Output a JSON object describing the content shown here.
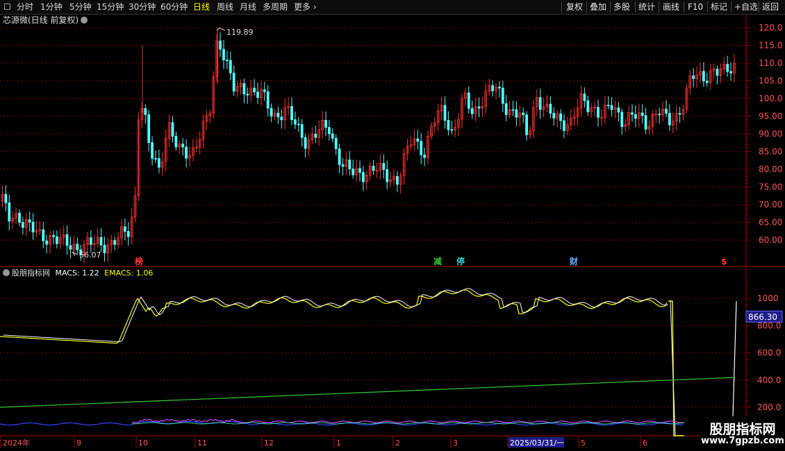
{
  "toolbar": {
    "periods": [
      "分时",
      "1分钟",
      "5分钟",
      "15分钟",
      "30分钟",
      "60分钟",
      "日线",
      "周线",
      "月线",
      "多周期",
      "更多"
    ],
    "active_period": "日线",
    "right_buttons": [
      "复权",
      "叠加",
      "多股",
      "统计",
      "画线",
      "F10",
      "标记",
      "+自选",
      "返回"
    ]
  },
  "chart": {
    "title": "芯源微(日线 前复权)",
    "price_axis": [
      "120.0",
      "115.0",
      "110.0",
      "105.0",
      "100.0",
      "95.00",
      "90.00",
      "85.00",
      "80.00",
      "75.00",
      "70.00",
      "65.00",
      "60.00"
    ],
    "high_label": "119.89",
    "low_label": "56.07",
    "event_markers": [
      {
        "text": "榜",
        "color": "#ff3333"
      },
      {
        "text": "减",
        "color": "#33cc33"
      },
      {
        "text": "停",
        "color": "#33cccc"
      },
      {
        "text": "财",
        "color": "#66aaff"
      },
      {
        "text": "$",
        "color": "#ff3333"
      }
    ]
  },
  "indicator": {
    "name": "股朋指标网",
    "macs_label": "MACS: 1.22",
    "emacs_label": "EMACS: 1.06",
    "axis": [
      "1000",
      "800.0",
      "600.0",
      "400.0",
      "200.0"
    ],
    "current_value": "866.30",
    "colors": {
      "macs": "#ffffff",
      "emacs": "#ffff00",
      "trend": "#33cc33"
    }
  },
  "time_axis": {
    "labels": [
      "2024年",
      "9",
      "10",
      "11",
      "12",
      "1",
      "2",
      "3",
      "2025/03/31/一",
      "5",
      "6"
    ]
  },
  "watermark": {
    "line1": "股朋指标网",
    "line2": "www.7gpzb.com"
  },
  "colors": {
    "up": "#ff3232",
    "down": "#54ffff",
    "grid": "#7a0000",
    "axis": "#aa0000",
    "active": "#ffff00"
  }
}
